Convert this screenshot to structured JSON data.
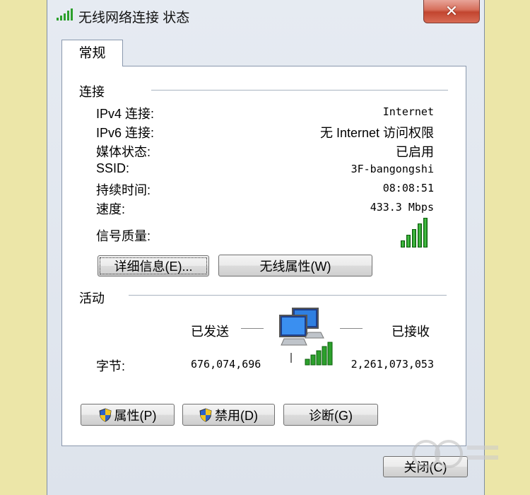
{
  "window": {
    "title": "无线网络连接 状态",
    "close_symbol": "✕"
  },
  "tabs": [
    {
      "label": "常规"
    }
  ],
  "connection": {
    "heading": "连接",
    "rows": [
      {
        "label": "IPv4 连接:",
        "value": "Internet"
      },
      {
        "label": "IPv6 连接:",
        "value": "无 Internet 访问权限"
      },
      {
        "label": "媒体状态:",
        "value": "已启用"
      },
      {
        "label": "SSID:",
        "value": "3F-bangongshi"
      },
      {
        "label": "持续时间:",
        "value": "08:08:51"
      },
      {
        "label": "速度:",
        "value": "433.3 Mbps"
      }
    ],
    "signal_label": "信号质量:",
    "signal_bars": 5
  },
  "buttons": {
    "details": "详细信息(E)...",
    "wireless_props": "无线属性(W)",
    "properties": "属性(P)",
    "disable": "禁用(D)",
    "diagnose": "诊断(G)",
    "close": "关闭(C)"
  },
  "activity": {
    "heading": "活动",
    "sent_label": "已发送",
    "received_label": "已接收",
    "bytes_label": "字节:",
    "bytes_sent": "676,074,696",
    "bytes_received": "2,261,073,053"
  },
  "icons": {
    "title": "wireless-signal-icon",
    "network": "network-computers-icon",
    "shield": "uac-shield-icon"
  },
  "colors": {
    "background": "#ece6a8",
    "signal_green": "#2ca02c",
    "close_red": "#c2452f"
  }
}
